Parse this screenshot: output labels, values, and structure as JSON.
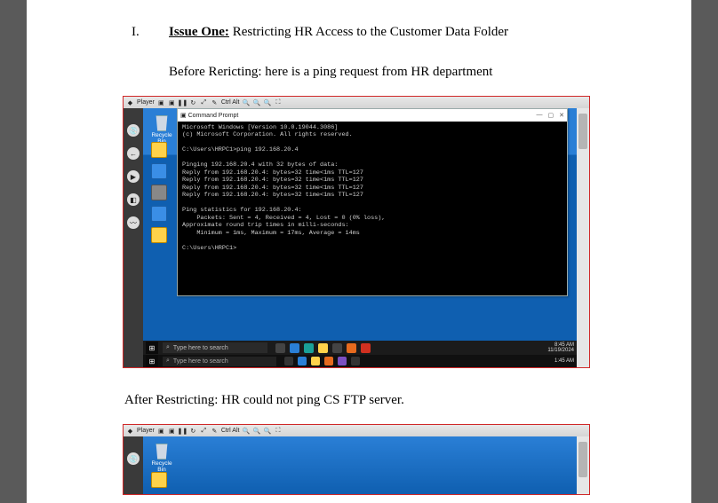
{
  "doc": {
    "roman": "I.",
    "issue_title": "Issue One:",
    "issue_rest": " Restricting HR Access to the Customer Data Folder",
    "before": "Before Rericting: here is a ping request from HR department",
    "after": "After Restricting: HR could not ping CS FTP server."
  },
  "topbar": {
    "player_label": "Player",
    "ctrl_alt": "Ctrl  Alt"
  },
  "recycle_label": "Recycle Bin",
  "cmd": {
    "title": "Command Prompt",
    "min": "—",
    "max": "▢",
    "close": "✕",
    "lines": "Microsoft Windows [Version 10.0.19044.3086]\n(c) Microsoft Corporation. All rights reserved.\n\nC:\\Users\\HRPC1>ping 192.168.20.4\n\nPinging 192.168.20.4 with 32 bytes of data:\nReply from 192.168.20.4: bytes=32 time<1ms TTL=127\nReply from 192.168.20.4: bytes=32 time<1ms TTL=127\nReply from 192.168.20.4: bytes=32 time<1ms TTL=127\nReply from 192.168.20.4: bytes=32 time<1ms TTL=127\n\nPing statistics for 192.168.20.4:\n    Packets: Sent = 4, Received = 4, Lost = 0 (0% loss),\nApproximate round trip times in milli-seconds:\n    Minimum = 1ms, Maximum = 17ms, Average = 14ms\n\nC:\\Users\\HRPC1>"
  },
  "taskbar": {
    "search_placeholder": "Type here to search",
    "time_inner": "8:45 AM",
    "date_inner": "11/19/2024",
    "time_host": "1:45 AM"
  }
}
